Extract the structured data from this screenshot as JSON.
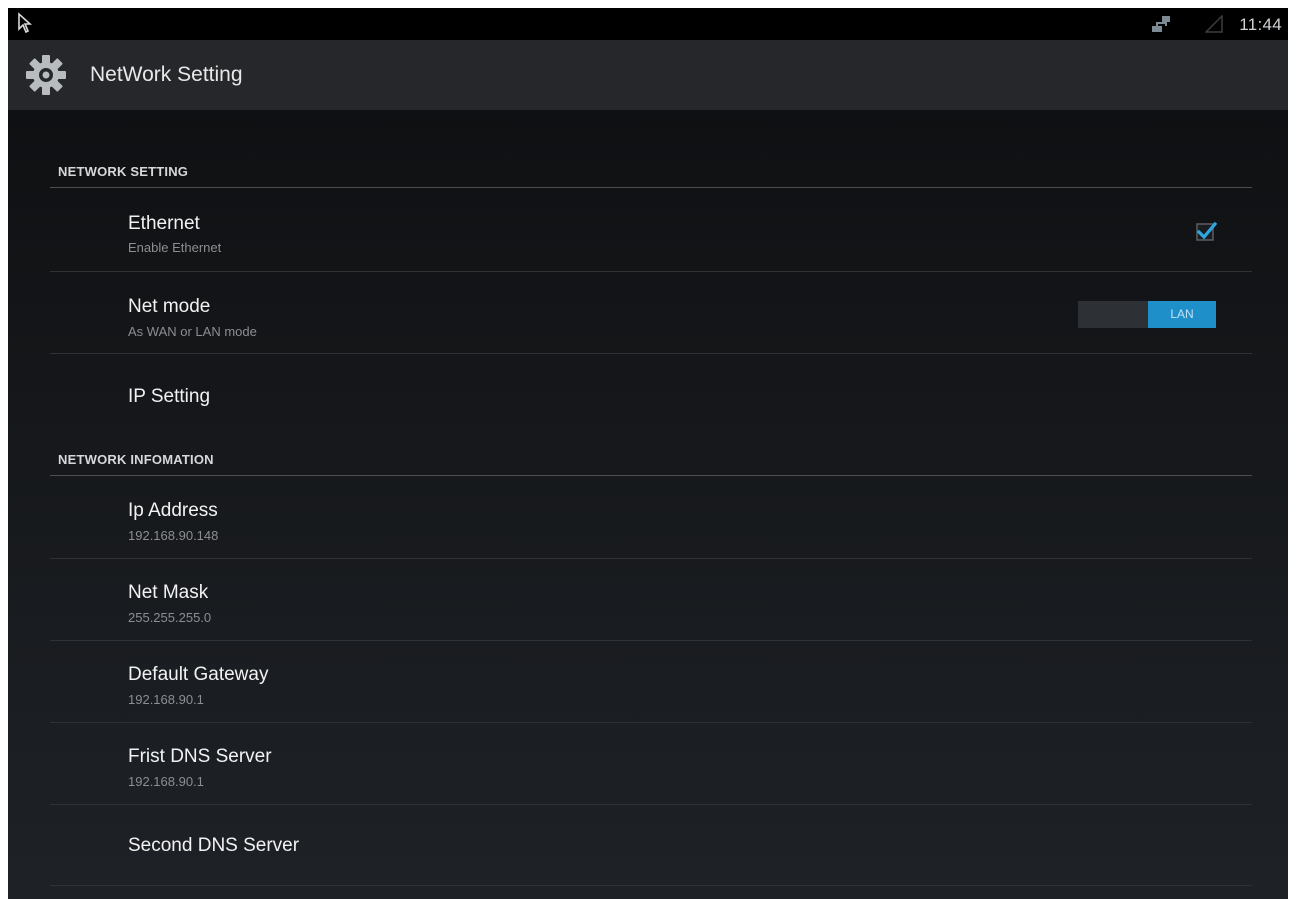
{
  "status_bar": {
    "time": "11:44",
    "left_icon": "screen-cast-icon",
    "network_icon": "ethernet-icon",
    "signal_icon": "signal-icon"
  },
  "action_bar": {
    "icon": "settings-gear-icon",
    "title": "NetWork Setting"
  },
  "sections": [
    {
      "header": "NETWORK SETTING",
      "items": [
        {
          "title": "Ethernet",
          "summary": "Enable Ethernet",
          "control": "checkbox",
          "checked": true
        },
        {
          "title": "Net mode",
          "summary": "As WAN or LAN mode",
          "control": "switch",
          "switch_label": "LAN"
        },
        {
          "title": "IP Setting"
        }
      ]
    },
    {
      "header": "NETWORK INFOMATION",
      "items": [
        {
          "title": "Ip Address",
          "summary": "192.168.90.148"
        },
        {
          "title": "Net Mask",
          "summary": "255.255.255.0"
        },
        {
          "title": "Default Gateway",
          "summary": "192.168.90.1"
        },
        {
          "title": "Frist DNS Server",
          "summary": "192.168.90.1"
        },
        {
          "title": "Second DNS Server"
        }
      ]
    }
  ],
  "colors": {
    "accent": "#1f8fc9",
    "background": "#15171a",
    "action_bar": "#26272a"
  }
}
